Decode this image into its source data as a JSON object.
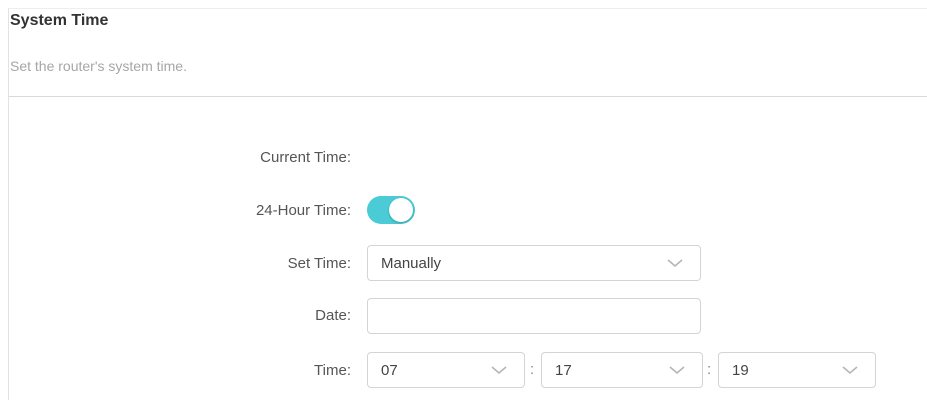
{
  "section": {
    "title": "System Time",
    "subtitle": "Set the router's system time."
  },
  "form": {
    "current_time_label": "Current Time:",
    "hour24_label": "24-Hour Time:",
    "hour24_enabled": true,
    "set_time_label": "Set Time:",
    "set_time_value": "Manually",
    "date_label": "Date:",
    "date_value": "",
    "time_label": "Time:",
    "time_separator": ":",
    "hour": "07",
    "minute": "17",
    "second": "19"
  },
  "colors": {
    "toggle_on": "#4acbd6",
    "border": "#d4d4d4",
    "muted_text": "#a6a6a6"
  },
  "icons": {
    "dropdown": "chevron-down-icon"
  }
}
